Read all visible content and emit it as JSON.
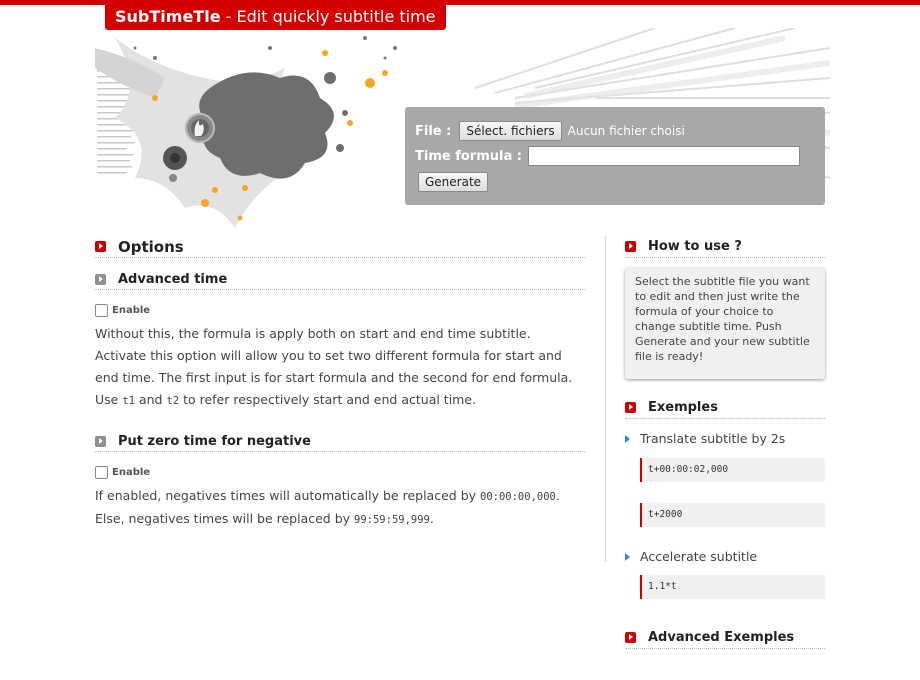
{
  "header": {
    "app_name": "SubTimeTle",
    "tagline": " - Edit quickly subtitle time"
  },
  "form": {
    "file_label": "File :",
    "file_button": "Sélect. fichiers",
    "file_status": "Aucun fichier choisi",
    "formula_label": "Time formula :",
    "formula_value": "",
    "generate_button": "Generate"
  },
  "options": {
    "title": "Options",
    "advanced_time": {
      "title": "Advanced time",
      "enable_label": "Enable",
      "desc_1": "Without this, the formula is apply both on start and end time subtitle. Activate this option will allow you to set two different formula for start and end time. The first input is for start formula and the second for end formula. Use ",
      "code_t1": "t1",
      "desc_2": " and ",
      "code_t2": "t2",
      "desc_3": " to refer respectively start and end actual time."
    },
    "zero_negative": {
      "title": "Put zero time for negative",
      "enable_label": "Enable",
      "line1_text": "If enabled, negatives times will automatically be replaced by ",
      "line1_code": "00:00:00,000",
      "line1_end": ".",
      "line2_text": "Else, negatives times will be replaced by ",
      "line2_code": "99:59:59,999",
      "line2_end": "."
    }
  },
  "sidebar": {
    "how_to_use": {
      "title": "How to use ?",
      "text": "Select the subtitle file you want to edit and then just write the formula of your choice to change subtitle time. Push Generate and your new subtitle file is ready!"
    },
    "exemples": {
      "title": "Exemples",
      "items": [
        {
          "label": "Translate subtitle by 2s",
          "codes": [
            "t+00:00:02,000",
            "t+2000"
          ]
        },
        {
          "label": "Accelerate subtitle",
          "codes": [
            "1.1*t"
          ]
        }
      ]
    },
    "advanced_exemples": {
      "title": "Advanced Exemples"
    }
  },
  "colors": {
    "accent": "#d40000",
    "panel": "#a8a8a8",
    "link_triangle": "#2a8fb8"
  }
}
